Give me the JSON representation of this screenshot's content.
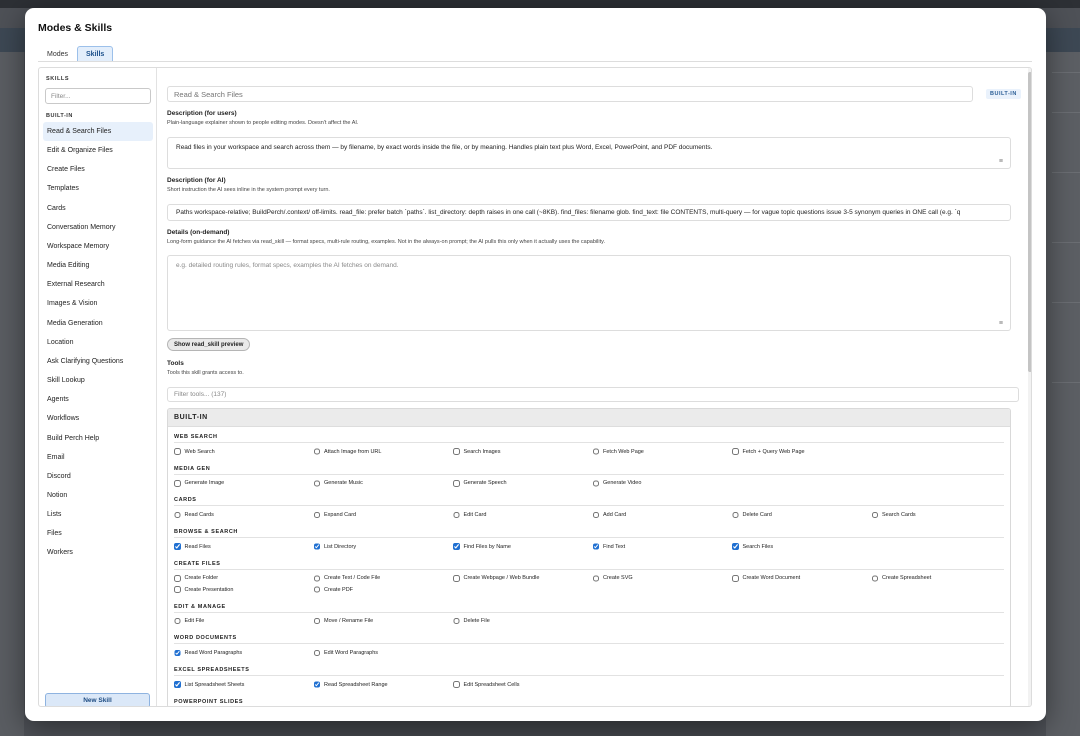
{
  "dialog": {
    "title": "Modes & Skills"
  },
  "tabs": [
    {
      "label": "Modes",
      "active": false
    },
    {
      "label": "Skills",
      "active": true
    }
  ],
  "sidebar": {
    "heading": "SKILLS",
    "filter_placeholder": "Filter...",
    "section": "BUILT-IN",
    "items": [
      "Read & Search Files",
      "Edit & Organize Files",
      "Create Files",
      "Templates",
      "Cards",
      "Conversation Memory",
      "Workspace Memory",
      "Media Editing",
      "External Research",
      "Images & Vision",
      "Media Generation",
      "Location",
      "Ask Clarifying Questions",
      "Skill Lookup",
      "Agents",
      "Workflows",
      "Build Perch Help",
      "Email",
      "Discord",
      "Notion",
      "Lists",
      "Files",
      "Workers"
    ],
    "active_item": "Read & Search Files",
    "new_button": "New Skill"
  },
  "skill": {
    "name_placeholder": "Read & Search Files",
    "badge": "BUILT-IN",
    "desc_users_label": "Description (for users)",
    "desc_users_hint": "Plain-language explainer shown to people editing modes. Doesn't affect the AI.",
    "desc_users_value": "Read files in your workspace and search across them — by filename, by exact words inside the file, or by meaning. Handles plain text plus Word, Excel, PowerPoint, and PDF documents.",
    "desc_ai_label": "Description (for AI)",
    "desc_ai_hint": "Short instruction the AI sees inline in the system prompt every turn.",
    "desc_ai_value": "Paths workspace-relative; BuildPerch/.context/ off-limits. read_file: prefer batch `paths`. list_directory: depth raises in one call (~8KB). find_files: filename glob. find_text: file CONTENTS, multi-query — for vague topic questions issue 3-5 synonym queries in ONE call (e.g. `q",
    "details_label": "Details (on-demand)",
    "details_hint": "Long-form guidance the AI fetches via read_skill — format specs, multi-rule routing, examples. Not in the always-on prompt; the AI pulls this only when it actually uses the capability.",
    "details_placeholder": "e.g. detailed routing rules, format specs, examples the AI fetches on demand.",
    "preview_button": "Show read_skill preview",
    "tools_label": "Tools",
    "tools_hint": "Tools this skill grants access to.",
    "tools_filter_placeholder": "Filter tools... (137)"
  },
  "tools": {
    "header": "BUILT-IN",
    "groups": [
      {
        "title": "WEB SEARCH",
        "items": [
          {
            "label": "Web Search",
            "checked": false
          },
          {
            "label": "Attach Image from URL",
            "checked": false
          },
          {
            "label": "Search Images",
            "checked": false
          },
          {
            "label": "Fetch Web Page",
            "checked": false
          },
          {
            "label": "Fetch + Query Web Page",
            "checked": false
          }
        ]
      },
      {
        "title": "MEDIA GEN",
        "items": [
          {
            "label": "Generate Image",
            "checked": false
          },
          {
            "label": "Generate Music",
            "checked": false
          },
          {
            "label": "Generate Speech",
            "checked": false
          },
          {
            "label": "Generate Video",
            "checked": false
          }
        ]
      },
      {
        "title": "CARDS",
        "items": [
          {
            "label": "Read Cards",
            "checked": false
          },
          {
            "label": "Expand Card",
            "checked": false
          },
          {
            "label": "Edit Card",
            "checked": false
          },
          {
            "label": "Add Card",
            "checked": false
          },
          {
            "label": "Delete Card",
            "checked": false
          },
          {
            "label": "Search Cards",
            "checked": false
          }
        ]
      },
      {
        "title": "BROWSE & SEARCH",
        "items": [
          {
            "label": "Read Files",
            "checked": true
          },
          {
            "label": "List Directory",
            "checked": true
          },
          {
            "label": "Find Files by Name",
            "checked": true
          },
          {
            "label": "Find Text",
            "checked": true
          },
          {
            "label": "Search Files",
            "checked": true
          }
        ]
      },
      {
        "title": "CREATE FILES",
        "items": [
          {
            "label": "Create Folder",
            "checked": false
          },
          {
            "label": "Create Text / Code File",
            "checked": false
          },
          {
            "label": "Create Webpage / Web Bundle",
            "checked": false
          },
          {
            "label": "Create SVG",
            "checked": false
          },
          {
            "label": "Create Word Document",
            "checked": false
          },
          {
            "label": "Create Spreadsheet",
            "checked": false
          },
          {
            "label": "Create Presentation",
            "checked": false
          },
          {
            "label": "Create PDF",
            "checked": false
          }
        ]
      },
      {
        "title": "EDIT & MANAGE",
        "items": [
          {
            "label": "Edit File",
            "checked": false
          },
          {
            "label": "Move / Rename File",
            "checked": false
          },
          {
            "label": "Delete File",
            "checked": false
          }
        ]
      },
      {
        "title": "WORD DOCUMENTS",
        "items": [
          {
            "label": "Read Word Paragraphs",
            "checked": true
          },
          {
            "label": "Edit Word Paragraphs",
            "checked": false
          }
        ]
      },
      {
        "title": "EXCEL SPREADSHEETS",
        "items": [
          {
            "label": "List Spreadsheet Sheets",
            "checked": true
          },
          {
            "label": "Read Spreadsheet Range",
            "checked": true
          },
          {
            "label": "Edit Spreadsheet Cells",
            "checked": false
          }
        ]
      },
      {
        "title": "POWERPOINT SLIDES",
        "items": []
      }
    ]
  },
  "colors": {
    "accent": "#1f6fd1",
    "badge_text": "#2c5f96",
    "active_item_bg": "#e7f0fb"
  }
}
